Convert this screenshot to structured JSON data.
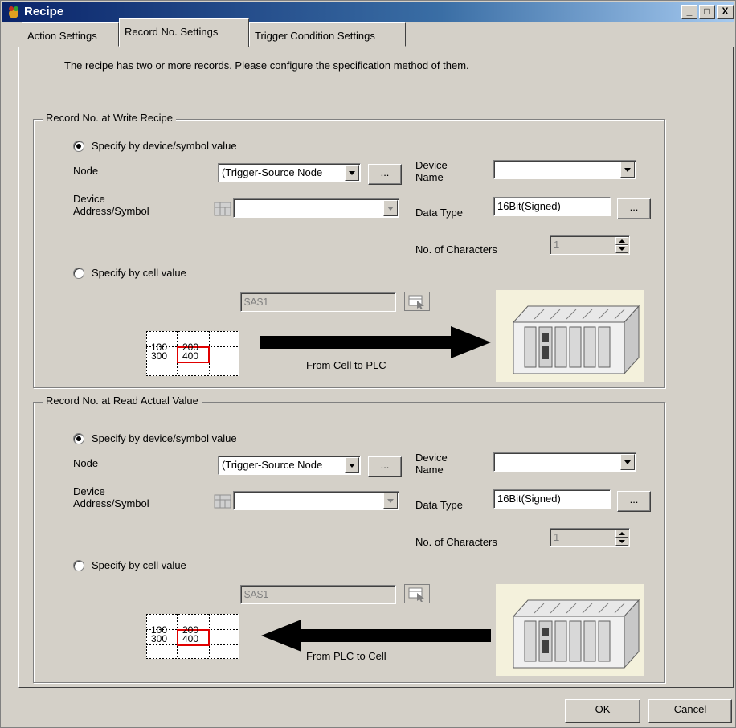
{
  "window": {
    "title": "Recipe",
    "min": "_",
    "max": "□",
    "close": "X"
  },
  "tabs": [
    "Action Settings",
    "Record No. Settings",
    "Trigger Condition Settings"
  ],
  "intro": "The recipe has two or more records. Please configure the specification method of them.",
  "write": {
    "group_label": "Record No. at Write Recipe",
    "radio_device": "Specify by device/symbol value",
    "node_label": "Node",
    "node_value": "(Trigger-Source Node",
    "browse": "...",
    "address_label_1": "Device",
    "address_label_2": "Address/Symbol",
    "device_name_label_1": "Device",
    "device_name_label_2": "Name",
    "device_name_value": "",
    "data_type_label": "Data Type",
    "data_type_value": "16Bit(Signed)",
    "chars_label": "No. of Characters",
    "chars_value": "1",
    "radio_cell": "Specify by cell value",
    "cell_value": "$A$1",
    "grid": [
      "100",
      "200",
      "300",
      "400"
    ],
    "arrow_label": "From Cell to PLC"
  },
  "read": {
    "group_label": "Record No. at Read Actual Value",
    "radio_device": "Specify by device/symbol value",
    "node_label": "Node",
    "node_value": "(Trigger-Source Node",
    "browse": "...",
    "address_label_1": "Device",
    "address_label_2": "Address/Symbol",
    "device_name_label_1": "Device",
    "device_name_label_2": "Name",
    "device_name_value": "",
    "data_type_label": "Data Type",
    "data_type_value": "16Bit(Signed)",
    "chars_label": "No. of Characters",
    "chars_value": "1",
    "radio_cell": "Specify by cell value",
    "cell_value": "$A$1",
    "grid": [
      "100",
      "200",
      "300",
      "400"
    ],
    "arrow_label": "From PLC to Cell"
  },
  "buttons": {
    "ok": "OK",
    "cancel": "Cancel"
  }
}
